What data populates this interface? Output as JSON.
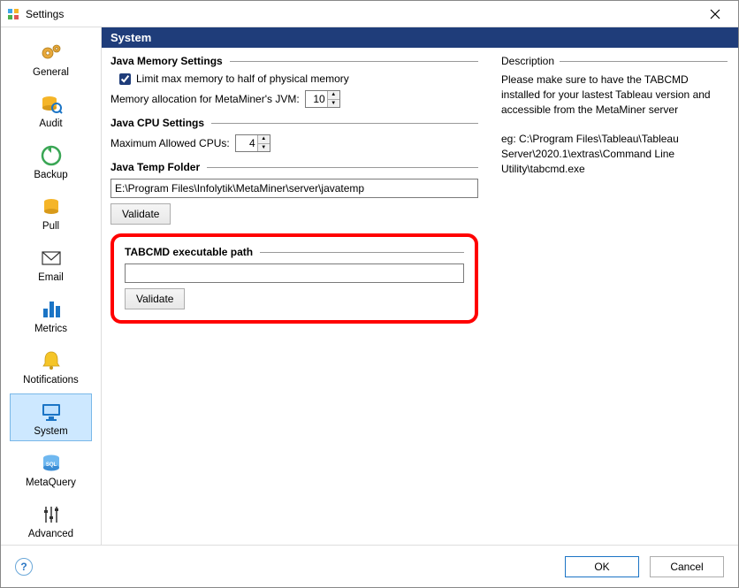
{
  "window": {
    "title": "Settings"
  },
  "sidebar": {
    "items": [
      {
        "label": "General"
      },
      {
        "label": "Audit"
      },
      {
        "label": "Backup"
      },
      {
        "label": "Pull"
      },
      {
        "label": "Email"
      },
      {
        "label": "Metrics"
      },
      {
        "label": "Notifications"
      },
      {
        "label": "System"
      },
      {
        "label": "MetaQuery"
      },
      {
        "label": "Advanced"
      }
    ]
  },
  "main": {
    "header": "System",
    "memory": {
      "group_title": "Java Memory Settings",
      "limit_label": "Limit max memory to half of physical memory",
      "limit_checked": true,
      "alloc_label": "Memory allocation for MetaMiner's JVM:",
      "alloc_value": "10"
    },
    "cpu": {
      "group_title": "Java CPU Settings",
      "max_label": "Maximum Allowed CPUs:",
      "max_value": "4"
    },
    "temp": {
      "group_title": "Java Temp Folder",
      "path_value": "E:\\Program Files\\Infolytik\\MetaMiner\\server\\javatemp",
      "validate_label": "Validate"
    },
    "tabcmd": {
      "group_title": "TABCMD executable path",
      "path_value": "",
      "validate_label": "Validate"
    }
  },
  "description": {
    "title": "Description",
    "para1": "Please make sure to have the TABCMD installed for your lastest Tableau version and accessible from the MetaMiner server",
    "para2": "eg: C:\\Program Files\\Tableau\\Tableau Server\\2020.1\\extras\\Command Line Utility\\tabcmd.exe"
  },
  "footer": {
    "ok": "OK",
    "cancel": "Cancel"
  }
}
